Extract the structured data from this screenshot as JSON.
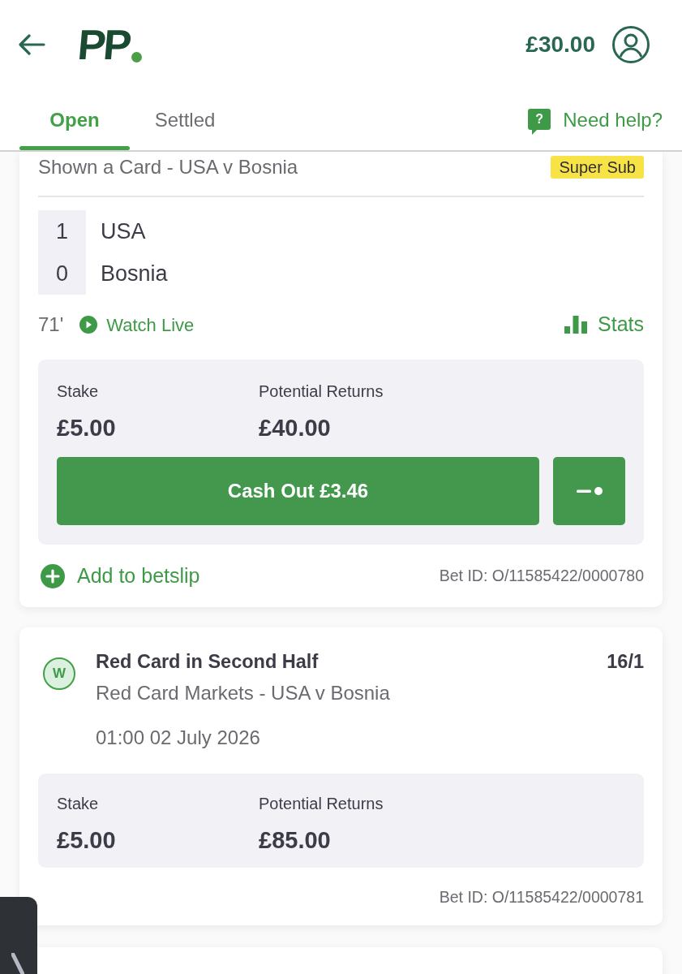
{
  "header": {
    "logo": "PP",
    "balance": "£30.00"
  },
  "tabs": [
    {
      "label": "Open",
      "selected": true
    },
    {
      "label": "Settled",
      "selected": false
    }
  ],
  "help": {
    "icon": "?",
    "label": "Need help?"
  },
  "bets": [
    {
      "kind": "live",
      "market": "Shown a Card - USA v Bosnia",
      "tag": "Super Sub",
      "scores": [
        {
          "score": "1",
          "team": "USA"
        },
        {
          "score": "0",
          "team": "Bosnia"
        }
      ],
      "minute": "71'",
      "watch_live": "Watch Live",
      "stats": "Stats",
      "stake_label": "Stake",
      "stake": "£5.00",
      "returns_label": "Potential Returns",
      "returns": "£40.00",
      "cash_out": "Cash Out £3.46",
      "add_to_betslip": "Add to betslip",
      "bet_id": "Bet ID: O/11585422/0000780"
    },
    {
      "kind": "result",
      "result": "W",
      "selection": "Red Card in Second Half",
      "odds": "16/1",
      "market": "Red Card Markets - USA v Bosnia",
      "date": "01:00 02 July 2026",
      "stake_label": "Stake",
      "stake": "£5.00",
      "returns_label": "Potential Returns",
      "returns": "£85.00",
      "bet_id": "Bet ID: O/11585422/0000781"
    }
  ]
}
